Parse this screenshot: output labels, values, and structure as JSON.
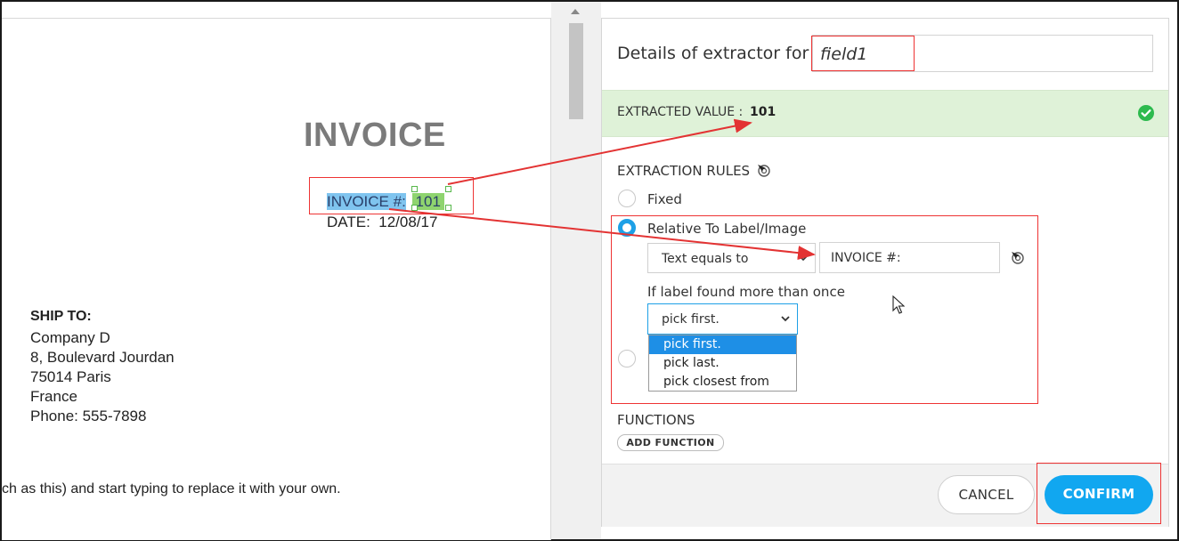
{
  "document": {
    "title": "INVOICE",
    "invoice_label": "INVOICE #:",
    "invoice_value": "101",
    "date_label": "DATE:",
    "date_value": "12/08/17",
    "ship_to": {
      "heading": "SHIP TO:",
      "lines": [
        "Company D",
        "8, Boulevard Jourdan",
        "75014 Paris",
        "France",
        "Phone:  555-7898"
      ]
    },
    "footer_text": "ch as this) and start typing to replace it with your own."
  },
  "panel": {
    "heading_prefix": "Details of extractor for",
    "field_name": "field1",
    "extracted_label": "EXTRACTED VALUE :",
    "extracted_value": "101",
    "rules_heading": "EXTRACTION RULES",
    "rule_fixed": "Fixed",
    "rule_relative": "Relative To Label/Image",
    "condition_select": "Text equals to",
    "label_input_value": "INVOICE #:",
    "multiple_label": "If label found more than once",
    "multiple_select": "pick first.",
    "dropdown_options": [
      "pick first.",
      "pick last.",
      "pick closest from"
    ],
    "functions_heading": "FUNCTIONS",
    "add_function": "ADD FUNCTION",
    "cancel": "CANCEL",
    "confirm": "CONFIRM"
  },
  "colors": {
    "accent": "#1ea0e6",
    "success": "#2dba4e",
    "success_bg": "#dff2d8",
    "annotation": "#e33333"
  }
}
